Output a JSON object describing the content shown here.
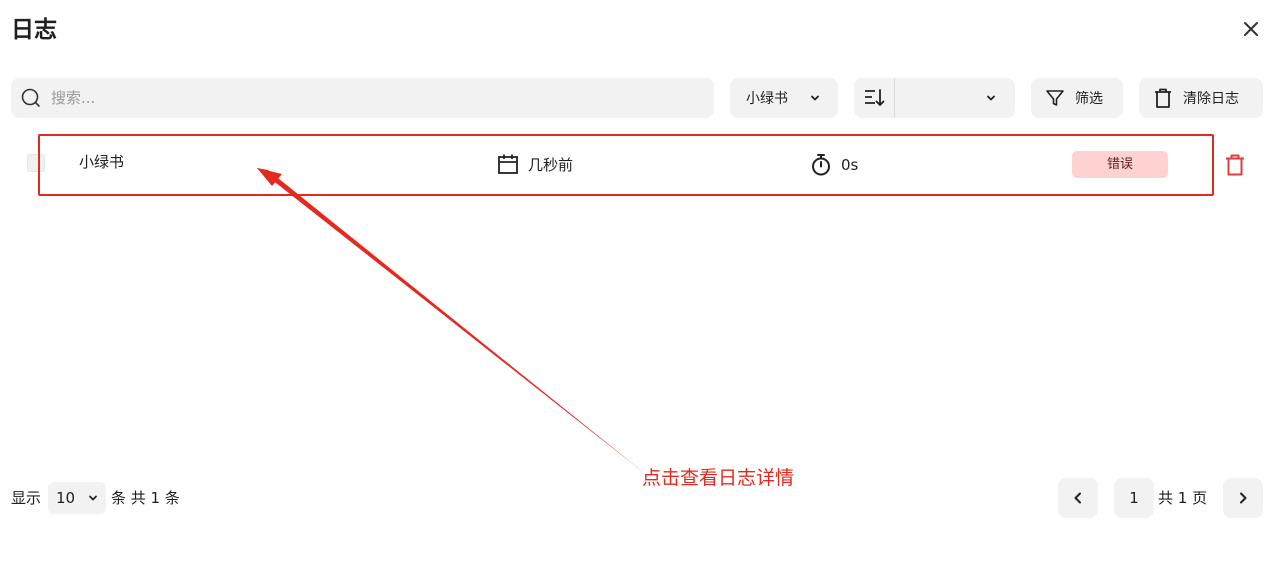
{
  "dialog": {
    "title": "日志"
  },
  "toolbar": {
    "search_placeholder": "搜索...",
    "app_filter_value": "小绿书",
    "sort_value": "",
    "filter_label": "筛选",
    "clear_label": "清除日志"
  },
  "log_rows": [
    {
      "app": "小绿书",
      "time": "几秒前",
      "duration": "0s",
      "status": "错误"
    }
  ],
  "annotation": {
    "text": "点击查看日志详情",
    "color": "#e32a20"
  },
  "pagination": {
    "show_label": "显示",
    "page_size": "10",
    "count_text": "条 共 1 条",
    "current_page": "1",
    "total_pages_text": "共 1 页"
  },
  "colors": {
    "accent_red": "#e32a20",
    "error_badge_bg": "#ffd2d2",
    "control_bg": "#f2f2f2"
  },
  "icons": [
    "close-icon",
    "search-icon",
    "chevron-down-icon",
    "sort-icon",
    "filter-icon",
    "trash-icon",
    "calendar-icon",
    "stopwatch-icon",
    "delete-icon",
    "chevron-left-icon",
    "chevron-right-icon"
  ]
}
